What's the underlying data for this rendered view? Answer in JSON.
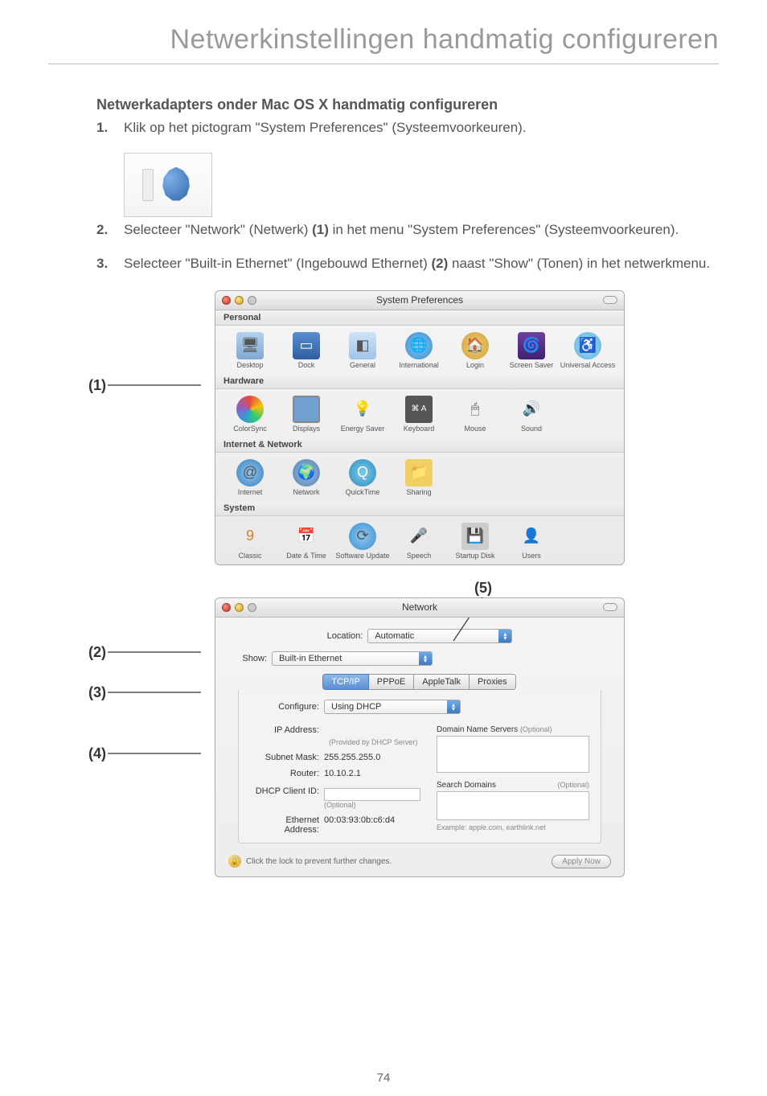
{
  "page": {
    "title": "Netwerkinstellingen handmatig configureren",
    "number": "74"
  },
  "heading": "Netwerkadapters onder Mac OS X handmatig configureren",
  "steps": {
    "s1_num": "1.",
    "s1": "Klik op het pictogram \"System Preferences\" (Systeemvoorkeuren).",
    "s2_num": "2.",
    "s2a": "Selecteer \"Network\" (Netwerk) ",
    "s2b": "(1)",
    "s2c": " in het menu \"System Preferences\" (Systeemvoorkeuren).",
    "s3_num": "3.",
    "s3a": "Selecteer \"Built-in Ethernet\" (Ingebouwd Ethernet) ",
    "s3b": "(2)",
    "s3c": " naast \"Show\" (Tonen) in het netwerkmenu."
  },
  "callouts": {
    "c1": "(1)",
    "c2": "(2)",
    "c3": "(3)",
    "c4": "(4)",
    "c5": "(5)"
  },
  "prefs_window": {
    "title": "System Preferences",
    "rows": {
      "personal": "Personal",
      "hardware": "Hardware",
      "internet_network": "Internet & Network",
      "system": "System"
    },
    "items": {
      "desktop": "Desktop",
      "dock": "Dock",
      "general": "General",
      "international": "International",
      "login": "Login",
      "screen_saver": "Screen Saver",
      "universal_access": "Universal Access",
      "colorsync": "ColorSync",
      "displays": "Displays",
      "energy_saver": "Energy Saver",
      "keyboard": "Keyboard",
      "mouse": "Mouse",
      "sound": "Sound",
      "internet": "Internet",
      "network": "Network",
      "quicktime": "QuickTime",
      "sharing": "Sharing",
      "classic": "Classic",
      "date_time": "Date & Time",
      "software_update": "Software Update",
      "speech": "Speech",
      "startup_disk": "Startup Disk",
      "users": "Users"
    }
  },
  "network_window": {
    "title": "Network",
    "location_label": "Location:",
    "location_value": "Automatic",
    "show_label": "Show:",
    "show_value": "Built-in Ethernet",
    "tabs": {
      "tcpip": "TCP/IP",
      "pppoe": "PPPoE",
      "appletalk": "AppleTalk",
      "proxies": "Proxies"
    },
    "configure_label": "Configure:",
    "configure_value": "Using DHCP",
    "dns_label": "Domain Name Servers",
    "dns_opt": "(Optional)",
    "ip_label": "IP Address:",
    "ip_hint": "(Provided by DHCP Server)",
    "subnet_label": "Subnet Mask:",
    "subnet_value": "255.255.255.0",
    "router_label": "Router:",
    "router_value": "10.10.2.1",
    "search_domains_label": "Search Domains",
    "search_domains_opt": "(Optional)",
    "dhcp_client_label": "DHCP Client ID:",
    "dhcp_client_hint": "(Optional)",
    "eth_addr_label": "Ethernet Address:",
    "eth_addr_value": "00:03:93:0b:c6:d4",
    "example_text": "Example: apple.com, earthlink.net",
    "lock_text": "Click the lock to prevent further changes.",
    "apply_button": "Apply Now"
  }
}
